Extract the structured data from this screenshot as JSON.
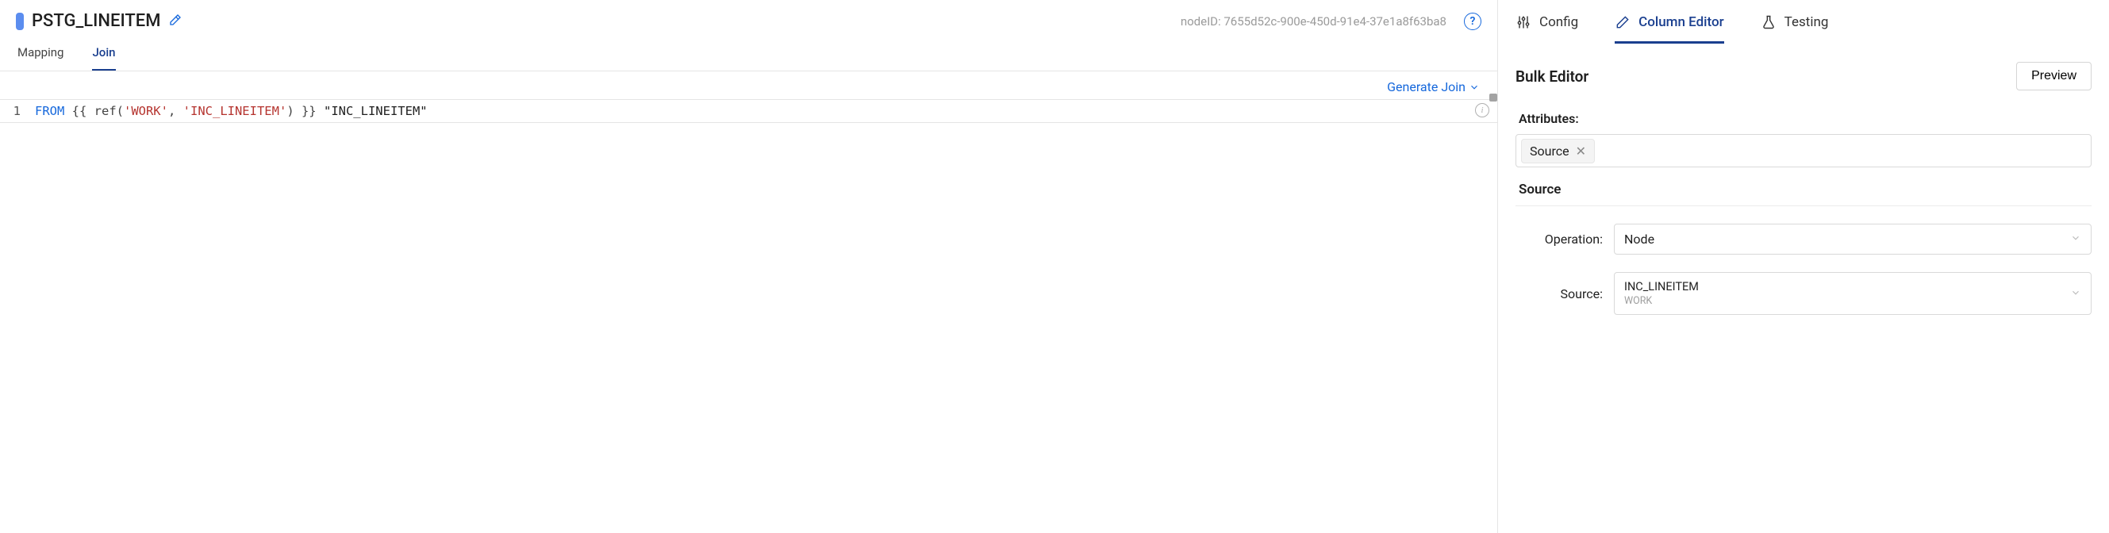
{
  "header": {
    "title": "PSTG_LINEITEM",
    "node_id_label": "nodeID: 7655d52c-900e-450d-91e4-37e1a8f63ba8"
  },
  "left_tabs": {
    "mapping": "Mapping",
    "join": "Join"
  },
  "generate_link": "Generate Join",
  "code": {
    "line_number": "1",
    "keyword": "FROM",
    "open": " {{ ref(",
    "arg1": "'WORK'",
    "sep": ", ",
    "arg2": "'INC_LINEITEM'",
    "close": ") }} ",
    "alias": "\"INC_LINEITEM\""
  },
  "right_tabs": {
    "config": "Config",
    "column_editor": "Column Editor",
    "testing": "Testing"
  },
  "bulk": {
    "title": "Bulk Editor",
    "preview": "Preview"
  },
  "attributes": {
    "label": "Attributes:",
    "chip": "Source"
  },
  "section": {
    "title": "Source"
  },
  "operation": {
    "label": "Operation:",
    "value": "Node"
  },
  "source": {
    "label": "Source:",
    "value": "INC_LINEITEM",
    "sub": "WORK"
  }
}
